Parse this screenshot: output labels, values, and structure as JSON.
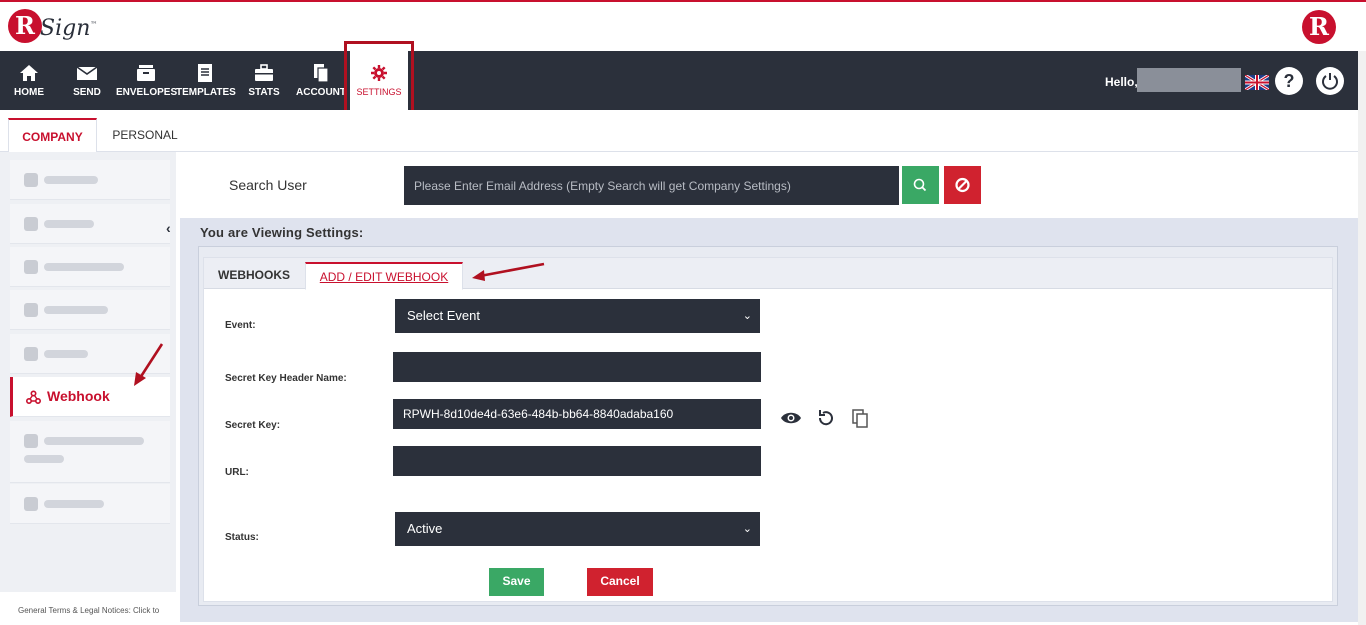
{
  "brand": {
    "logo_letter": "R",
    "logo_word": "Sign",
    "tm": "™",
    "right_logo_letter": "R"
  },
  "nav": {
    "items": [
      {
        "label": "HOME",
        "icon": "home-icon"
      },
      {
        "label": "SEND",
        "icon": "envelope-icon"
      },
      {
        "label": "ENVELOPES",
        "icon": "inbox-icon"
      },
      {
        "label": "TEMPLATES",
        "icon": "templates-icon"
      },
      {
        "label": "STATS",
        "icon": "briefcase-icon"
      },
      {
        "label": "ACCOUNT",
        "icon": "account-icon"
      },
      {
        "label": "SETTINGS",
        "icon": "gear-icon"
      }
    ],
    "hello": "Hello,",
    "help": "?",
    "colors": {
      "bar": "#2b303b",
      "accent": "#c8102e"
    }
  },
  "top_tabs": {
    "company": "COMPANY",
    "personal": "PERSONAL"
  },
  "sidebar": {
    "webhook_label": "Webhook"
  },
  "search": {
    "label": "Search User",
    "placeholder": "Please Enter Email Address (Empty Search will get Company Settings)"
  },
  "panel": {
    "title": "You are Viewing Settings:",
    "tabs": {
      "webhooks": "WEBHOOKS",
      "add_edit": "ADD / EDIT WEBHOOK"
    },
    "form": {
      "event_label": "Event:",
      "event_value": "Select Event",
      "secret_header_label": "Secret Key Header Name:",
      "secret_header_value": "",
      "secret_key_label": "Secret Key:",
      "secret_key_value": "RPWH-8d10de4d-63e6-484b-bb64-8840adaba160",
      "url_label": "URL:",
      "url_value": "",
      "status_label": "Status:",
      "status_value": "Active",
      "save": "Save",
      "cancel": "Cancel"
    }
  },
  "footer": {
    "text": "General Terms & Legal Notices: Click to"
  }
}
